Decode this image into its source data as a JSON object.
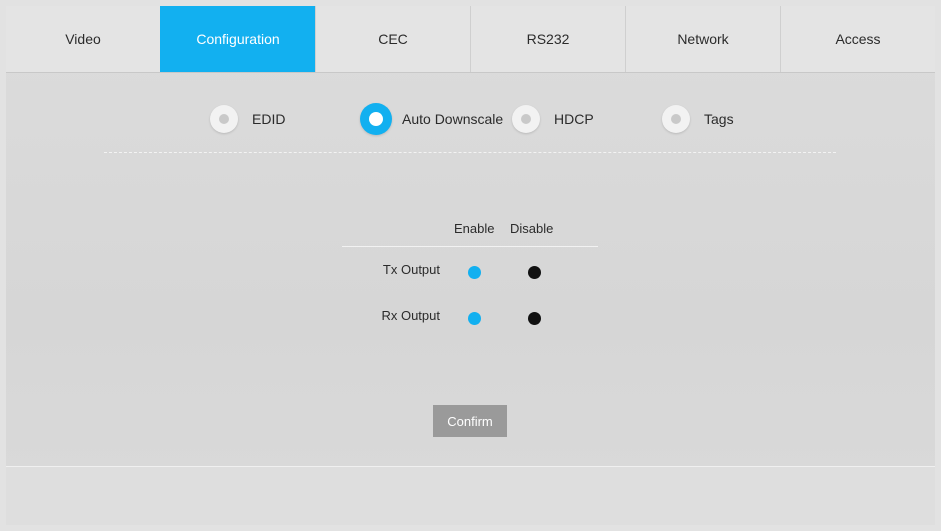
{
  "tabs": [
    {
      "label": "Video",
      "active": false
    },
    {
      "label": "Configuration",
      "active": true
    },
    {
      "label": "CEC",
      "active": false
    },
    {
      "label": "RS232",
      "active": false
    },
    {
      "label": "Network",
      "active": false
    },
    {
      "label": "Access",
      "active": false
    }
  ],
  "subtabs": [
    {
      "label": "EDID",
      "selected": false
    },
    {
      "label": "Auto Downscale",
      "selected": true
    },
    {
      "label": "HDCP",
      "selected": false
    },
    {
      "label": "Tags",
      "selected": false
    }
  ],
  "options": {
    "columns": [
      "Enable",
      "Disable"
    ],
    "rows": [
      {
        "label": "Tx Output",
        "value": "Enable"
      },
      {
        "label": "Rx Output",
        "value": "Enable"
      }
    ]
  },
  "confirm_label": "Confirm",
  "colors": {
    "accent": "#12b0f0",
    "background": "#d8d8d8",
    "disable_dot": "#111111",
    "button": "#9a9a9a"
  }
}
